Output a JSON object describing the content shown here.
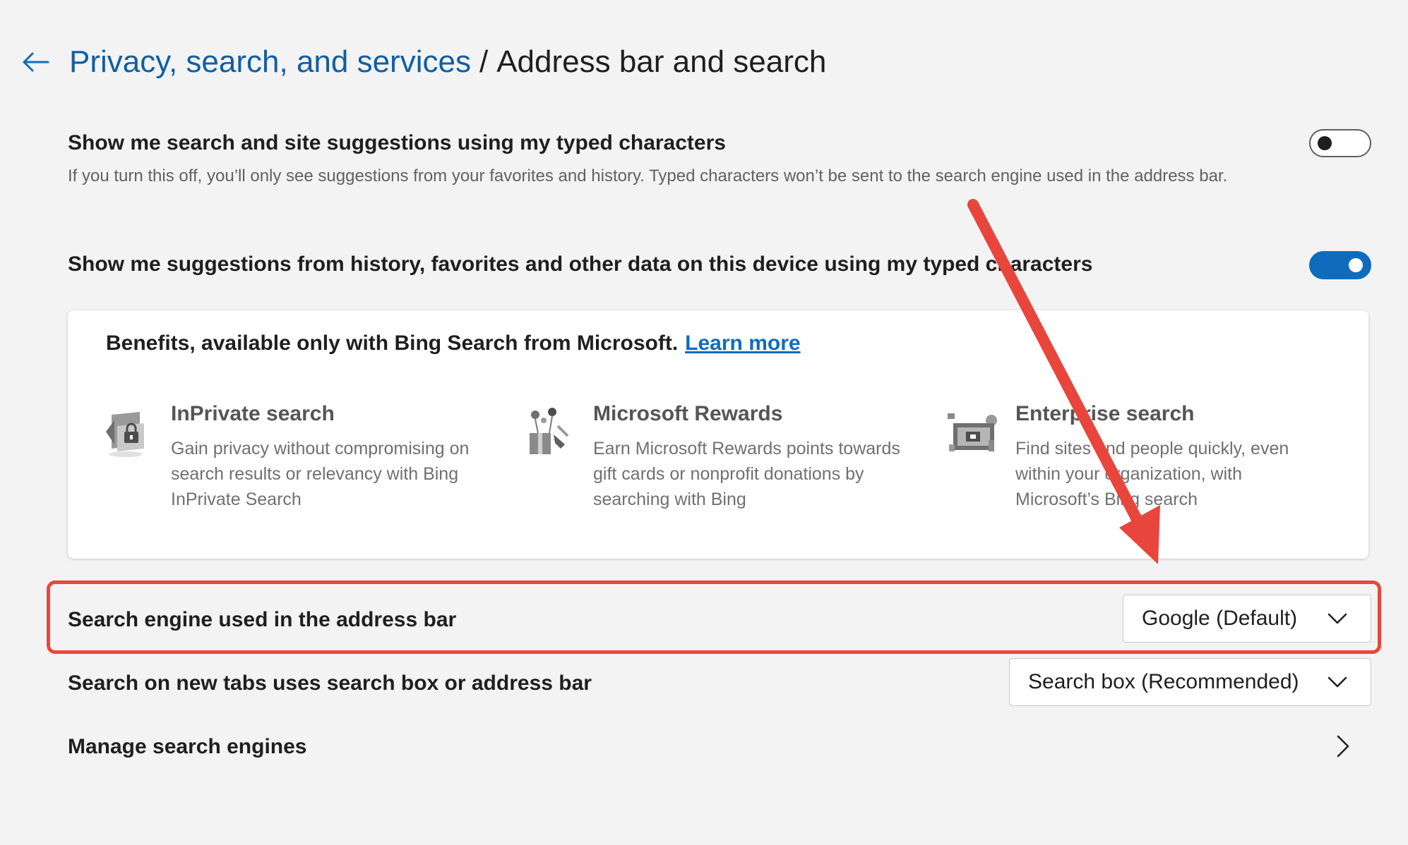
{
  "header": {
    "breadcrumb_parent": "Privacy, search, and services",
    "separator": "/",
    "title": "Address bar and search"
  },
  "settings": {
    "typed_suggestions": {
      "label": "Show me search and site suggestions using my typed characters",
      "description": "If you turn this off, you’ll only see suggestions from your favorites and history. Typed characters won’t be sent to the search engine used in the address bar.",
      "enabled": false
    },
    "local_suggestions": {
      "label": "Show me suggestions from history, favorites and other data on this device using my typed characters",
      "enabled": true
    },
    "search_engine": {
      "label": "Search engine used in the address bar",
      "value": "Google (Default)"
    },
    "new_tab_search": {
      "label": "Search on new tabs uses search box or address bar",
      "value": "Search box (Recommended)"
    },
    "manage_engines": {
      "label": "Manage search engines"
    }
  },
  "benefits": {
    "title": "Benefits, available only with Bing Search from Microsoft.",
    "link": "Learn more",
    "items": [
      {
        "icon": "inprivate-search-icon",
        "title": "InPrivate search",
        "description": "Gain privacy without compromising on search results or relevancy with Bing InPrivate Search"
      },
      {
        "icon": "microsoft-rewards-icon",
        "title": "Microsoft Rewards",
        "description": "Earn Microsoft Rewards points towards gift cards or nonprofit donations by searching with Bing"
      },
      {
        "icon": "enterprise-search-icon",
        "title": "Enterprise search",
        "description": "Find sites and people quickly, even within your organization, with Microsoft’s Bing search"
      }
    ]
  },
  "colors": {
    "accent": "#0f6cbd",
    "link": "#115ea3",
    "annotation": "#e8463d",
    "background": "#f3f3f3"
  }
}
